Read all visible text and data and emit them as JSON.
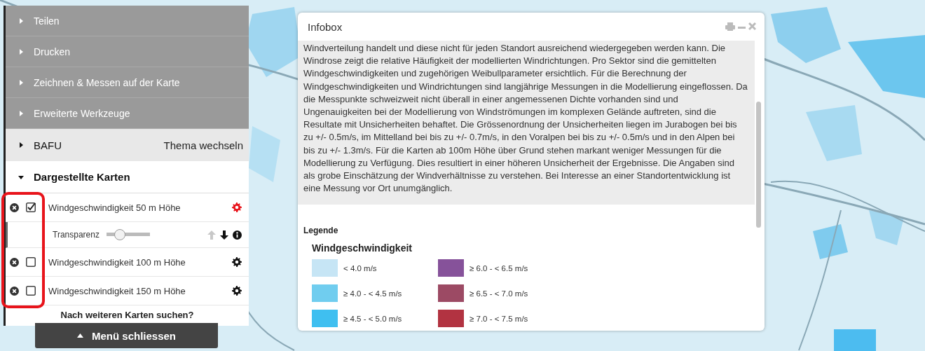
{
  "menu": [
    {
      "kind": "tool",
      "label": "Teilen",
      "expanded": false
    },
    {
      "kind": "tool",
      "label": "Drucken",
      "expanded": false
    },
    {
      "kind": "tool",
      "label": "Zeichnen & Messen auf der Karte",
      "expanded": false
    },
    {
      "kind": "tool",
      "label": "Erweiterte Werkzeuge",
      "expanded": false
    },
    {
      "kind": "theme",
      "label": "BAFU",
      "expanded": false,
      "action": "Thema wechseln"
    },
    {
      "kind": "section",
      "label": "Dargestellte Karten",
      "expanded": true
    }
  ],
  "layers_highlighted": true,
  "layers": [
    {
      "name": "Windgeschwindigkeit 50 m Höhe",
      "checked": true,
      "expanded": true,
      "transparency_label": "Transparenz",
      "level": 0.3,
      "up_disabled": true,
      "down_disabled": false
    },
    {
      "name": "Windgeschwindigkeit 100 m Höhe",
      "checked": false,
      "expanded": false
    },
    {
      "name": "Windgeschwindigkeit 150 m Höhe",
      "checked": false,
      "expanded": false
    }
  ],
  "search_more": "Nach weiteren Karten suchen?",
  "close_menu": "Menü schliessen",
  "infobox": {
    "title": "Infobox",
    "text": "Windverteilung handelt und diese nicht für jeden Standort ausreichend wiedergegeben werden kann. Die Windrose zeigt die relative Häufigkeit der modellierten Windrichtungen. Pro Sektor sind die gemittelten Windgeschwindigkeiten und zugehörigen Weibullparameter ersichtlich. Für die Berechnung der Windgeschwindigkeiten und Windrichtungen sind langjährige Messungen in die Modellierung eingeflossen. Da die Messpunkte schweizweit nicht überall in einer angemessenen Dichte vorhanden sind und Ungenauigkeiten bei der Modellierung von Windströmungen im komplexen Gelände auftreten, sind die Resultate mit Unsicherheiten behaftet. Die Grössenordnung der Unsicherheiten liegen im Jurabogen bei bis zu +/- 0.5m/s, im Mittelland bei bis zu +/- 0.7m/s, in den Voralpen bei bis zu +/- 0.5m/s und in den Alpen bei bis zu +/- 1.3m/s. Für die Karten ab 100m Höhe über Grund stehen markant weniger Messungen für die Modellierung zu Verfügung. Dies resultiert in einer höheren Unsicherheit der Ergebnisse. Die Angaben sind als grobe Einschätzung der Windverhältnisse zu verstehen. Bei Interesse an einer Standortentwicklung ist eine Messung vor Ort unumgänglich.",
    "legend_heading": "Legende",
    "legend_title": "Windgeschwindigkeit",
    "legend": [
      {
        "label": "< 4.0 m/s",
        "color": "#c6e5f5"
      },
      {
        "label": "≥ 6.0 - < 6.5 m/s",
        "color": "#86529a"
      },
      {
        "label": "≥ 4.0 - < 4.5 m/s",
        "color": "#70cdef"
      },
      {
        "label": "≥ 6.5 - < 7.0 m/s",
        "color": "#9c4a64"
      },
      {
        "label": "≥ 4.5 - < 5.0 m/s",
        "color": "#3fbff0"
      },
      {
        "label": "≥ 7.0 - < 7.5 m/s",
        "color": "#b23341"
      }
    ]
  }
}
